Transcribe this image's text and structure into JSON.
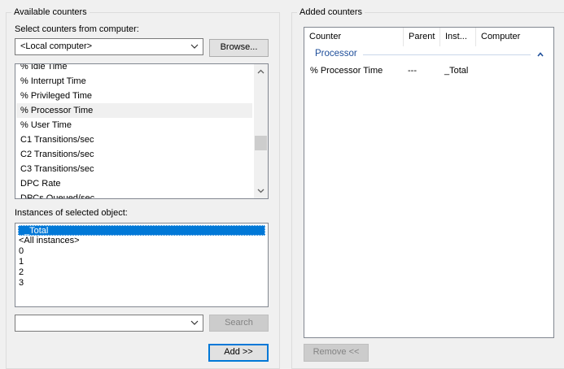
{
  "available": {
    "group_title": "Available counters",
    "select_label": "Select counters from computer:",
    "computer_value": "<Local computer>",
    "browse_label": "Browse...",
    "counters": [
      "% Idle Time",
      "% Interrupt Time",
      "% Privileged Time",
      "% Processor Time",
      "% User Time",
      "C1 Transitions/sec",
      "C2 Transitions/sec",
      "C3 Transitions/sec",
      "DPC Rate",
      "DPCs Queued/sec"
    ],
    "highlighted_counter": "% Processor Time",
    "instances_label": "Instances of selected object:",
    "instances": [
      "_Total",
      "<All instances>",
      "0",
      "1",
      "2",
      "3"
    ],
    "selected_instance": "_Total",
    "search_value": "",
    "search_label": "Search",
    "add_label": "Add >>"
  },
  "added": {
    "group_title": "Added counters",
    "columns": [
      "Counter",
      "Parent",
      "Inst...",
      "Computer"
    ],
    "object_group": "Processor",
    "rows": [
      {
        "counter": "% Processor Time",
        "parent": "---",
        "instance": "_Total",
        "computer": ""
      }
    ],
    "remove_label": "Remove <<"
  },
  "colors": {
    "selection": "#0078d7",
    "group_text": "#1e4e9a",
    "disabled_text": "#838383"
  }
}
